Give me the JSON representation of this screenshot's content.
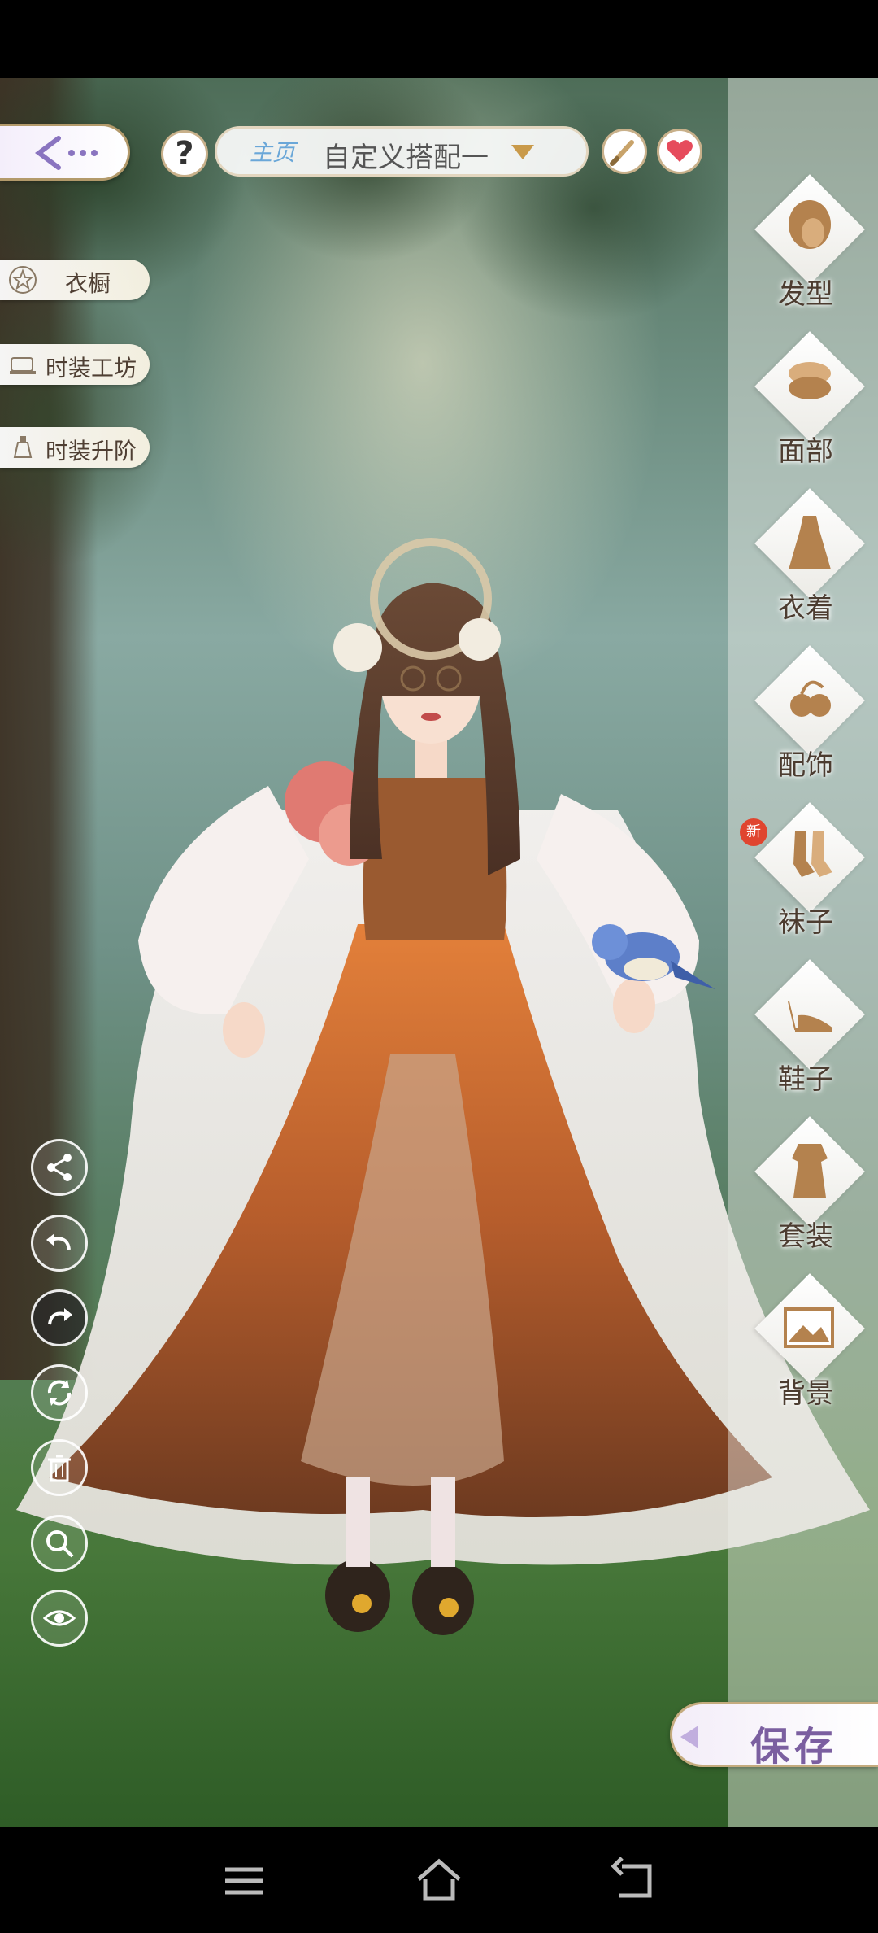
{
  "top_bar": {
    "outfit_tag": "主页",
    "outfit_name": "自定义搭配一",
    "help_label": "?"
  },
  "left_menu": [
    {
      "label": "衣橱",
      "icon": "star-icon"
    },
    {
      "label": "时装工坊",
      "icon": "sewing-machine-icon"
    },
    {
      "label": "时装升阶",
      "icon": "bottle-icon"
    }
  ],
  "categories": [
    {
      "label": "发型",
      "icon": "hairstyle-icon"
    },
    {
      "label": "面部",
      "icon": "makeup-compact-icon"
    },
    {
      "label": "衣着",
      "icon": "dress-icon"
    },
    {
      "label": "配饰",
      "icon": "accessory-icon"
    },
    {
      "label": "袜子",
      "icon": "socks-icon",
      "badge": "新"
    },
    {
      "label": "鞋子",
      "icon": "high-heel-icon"
    },
    {
      "label": "套装",
      "icon": "outfit-set-icon"
    },
    {
      "label": "背景",
      "icon": "background-photo-icon"
    }
  ],
  "tools": [
    "share-icon",
    "undo-icon",
    "redo-icon",
    "rotate-icon",
    "trash-icon",
    "zoom-icon",
    "eye-icon"
  ],
  "save": {
    "label": "保存"
  },
  "colors": {
    "accent_gold": "#c8b08a",
    "save_text": "#7b5fa0",
    "badge_red": "#e0452f"
  }
}
